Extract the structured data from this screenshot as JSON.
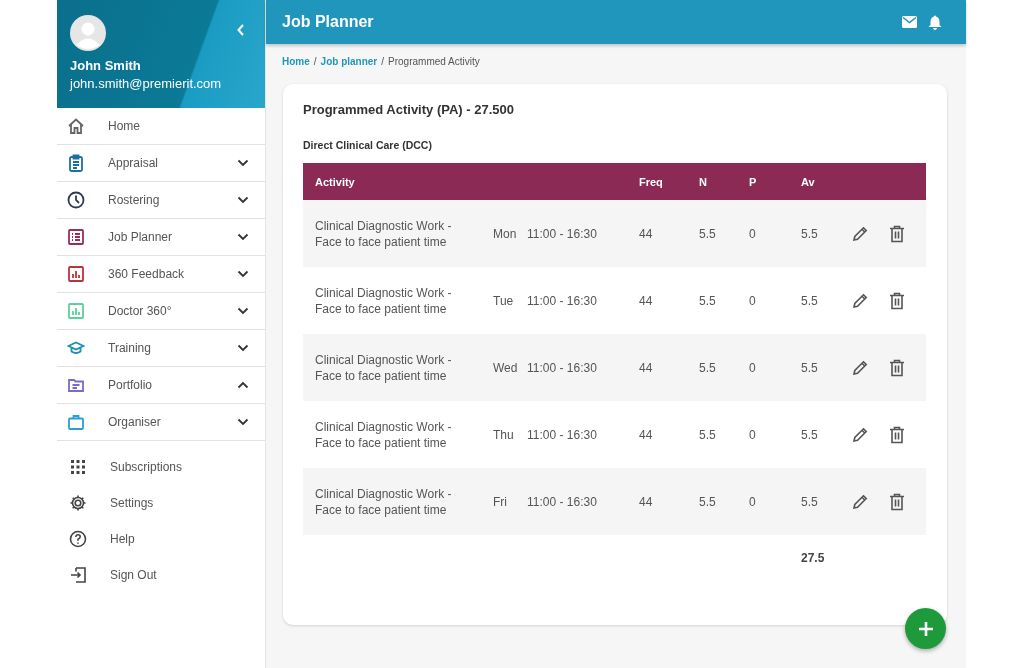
{
  "user": {
    "name": "John Smith",
    "email": "john.smith@premierit.com"
  },
  "nav": [
    {
      "label": "Home",
      "kind": "link"
    },
    {
      "label": "Appraisal",
      "kind": "group",
      "expanded": false
    },
    {
      "label": "Rostering",
      "kind": "group",
      "expanded": false
    },
    {
      "label": "Job Planner",
      "kind": "group",
      "expanded": false
    },
    {
      "label": "360 Feedback",
      "kind": "group",
      "expanded": false
    },
    {
      "label": "Doctor 360°",
      "kind": "group",
      "expanded": false
    },
    {
      "label": "Training",
      "kind": "group",
      "expanded": false
    },
    {
      "label": "Portfolio",
      "kind": "group",
      "expanded": true
    },
    {
      "label": "Organiser",
      "kind": "group",
      "expanded": false
    }
  ],
  "footer_nav": [
    "Subscriptions",
    "Settings",
    "Help",
    "Sign Out"
  ],
  "header": {
    "title": "Job Planner"
  },
  "breadcrumb": {
    "links": [
      {
        "label": "Home",
        "separator": "/"
      },
      {
        "label": "Job planner",
        "separator": "/"
      }
    ],
    "current": "Programmed Activity"
  },
  "card": {
    "title": "Programmed Activity (PA) - 27.500",
    "section": "Direct Clinical Care (DCC)",
    "table": {
      "columns": [
        "Activity",
        "Freq",
        "N",
        "P",
        "Av"
      ],
      "rows": [
        {
          "activity": "Clinical Diagnostic Work - Face to face patient time",
          "day": "Mon",
          "time": "11:00 - 16:30",
          "freq": "44",
          "n": "5.5",
          "p": "0",
          "av": "5.5"
        },
        {
          "activity": "Clinical Diagnostic Work - Face to face patient time",
          "day": "Tue",
          "time": "11:00 - 16:30",
          "freq": "44",
          "n": "5.5",
          "p": "0",
          "av": "5.5"
        },
        {
          "activity": "Clinical Diagnostic Work - Face to face patient time",
          "day": "Wed",
          "time": "11:00 - 16:30",
          "freq": "44",
          "n": "5.5",
          "p": "0",
          "av": "5.5"
        },
        {
          "activity": "Clinical Diagnostic Work - Face to face patient time",
          "day": "Thu",
          "time": "11:00 - 16:30",
          "freq": "44",
          "n": "5.5",
          "p": "0",
          "av": "5.5"
        },
        {
          "activity": "Clinical Diagnostic Work - Face to face patient time",
          "day": "Fri",
          "time": "11:00 - 16:30",
          "freq": "44",
          "n": "5.5",
          "p": "0",
          "av": "5.5"
        }
      ],
      "total": "27.5"
    }
  }
}
